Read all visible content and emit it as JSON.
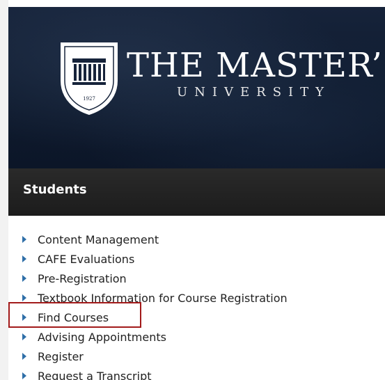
{
  "banner": {
    "brand_name": "THE MASTER’S",
    "brand_sub": "UNIVERSITY",
    "crest_year": "1927"
  },
  "section": {
    "title": "Students"
  },
  "nav": {
    "items": [
      {
        "label": "Content Management"
      },
      {
        "label": "CAFE Evaluations"
      },
      {
        "label": "Pre-Registration"
      },
      {
        "label": "Textbook Information for Course Registration"
      },
      {
        "label": "Find Courses"
      },
      {
        "label": "Advising Appointments"
      },
      {
        "label": "Register"
      },
      {
        "label": "Request a Transcript"
      }
    ]
  },
  "colors": {
    "banner_navy": "#0f1b2f",
    "section_bar": "#222222",
    "bullet_blue": "#2f6fa8",
    "highlight_red": "#a21a1a"
  },
  "icons": {
    "crest": "university-crest-icon",
    "bullet": "bullet-arrow-icon"
  }
}
